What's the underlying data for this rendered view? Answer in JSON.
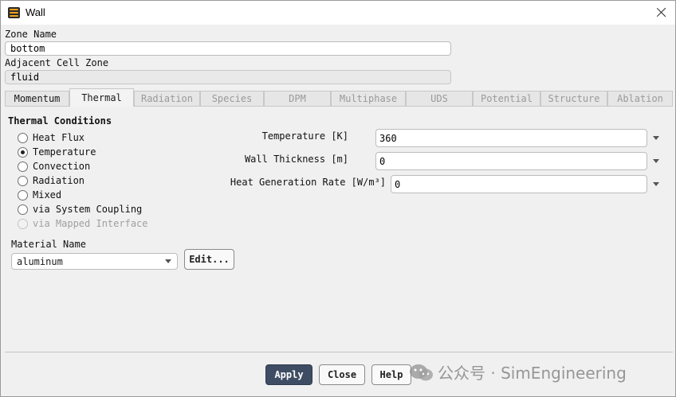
{
  "window": {
    "title": "Wall"
  },
  "zone": {
    "label": "Zone Name",
    "value": "bottom"
  },
  "adjacent": {
    "label": "Adjacent Cell Zone",
    "value": "fluid"
  },
  "tabs": [
    {
      "label": "Momentum",
      "state": "enabled"
    },
    {
      "label": "Thermal",
      "state": "active"
    },
    {
      "label": "Radiation",
      "state": "disabled"
    },
    {
      "label": "Species",
      "state": "disabled"
    },
    {
      "label": "DPM",
      "state": "disabled"
    },
    {
      "label": "Multiphase",
      "state": "disabled"
    },
    {
      "label": "UDS",
      "state": "disabled"
    },
    {
      "label": "Potential",
      "state": "disabled"
    },
    {
      "label": "Structure",
      "state": "disabled"
    },
    {
      "label": "Ablation",
      "state": "disabled"
    }
  ],
  "thermal": {
    "title": "Thermal Conditions",
    "options": [
      {
        "label": "Heat Flux",
        "checked": false,
        "disabled": false
      },
      {
        "label": "Temperature",
        "checked": true,
        "disabled": false
      },
      {
        "label": "Convection",
        "checked": false,
        "disabled": false
      },
      {
        "label": "Radiation",
        "checked": false,
        "disabled": false
      },
      {
        "label": "Mixed",
        "checked": false,
        "disabled": false
      },
      {
        "label": "via System Coupling",
        "checked": false,
        "disabled": false
      },
      {
        "label": "via Mapped Interface",
        "checked": false,
        "disabled": true
      }
    ],
    "temperature": {
      "label": "Temperature [K]",
      "value": "360"
    },
    "wall_thickness": {
      "label": "Wall Thickness [m]",
      "value": "0"
    },
    "heat_generation": {
      "label": "Heat Generation Rate [W/m³]",
      "value": "0"
    }
  },
  "material": {
    "label": "Material Name",
    "value": "aluminum",
    "edit_label": "Edit..."
  },
  "footer": {
    "apply": "Apply",
    "close": "Close",
    "help": "Help"
  },
  "watermark": {
    "text": "公众号 · SimEngineering"
  },
  "colors": {
    "accent": "#3e4d63",
    "icon": "#f2a11b"
  }
}
